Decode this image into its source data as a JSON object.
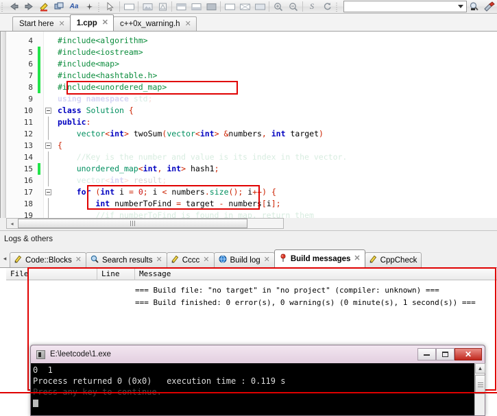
{
  "app": {
    "title": "Code::Blocks IDE"
  },
  "toolbar": {
    "items": [
      {
        "name": "back-arrow-icon",
        "glyph": "⇦"
      },
      {
        "name": "forward-arrow-icon",
        "glyph": "⇨"
      },
      {
        "name": "highlight-pen-icon",
        "glyph": "✎"
      },
      {
        "name": "copy-block-icon",
        "glyph": "❐"
      },
      {
        "name": "font-aa-icon",
        "glyph": "Aa"
      },
      {
        "name": "sparkle-icon",
        "glyph": "✳"
      },
      {
        "name": "pointer-select-icon",
        "glyph": "➤"
      },
      {
        "name": "rectangle-icon",
        "glyph": "▭"
      },
      {
        "name": "image-icon",
        "glyph": "▧"
      },
      {
        "name": "document-icon",
        "glyph": "△"
      },
      {
        "name": "panel-top-icon",
        "glyph": "▤"
      },
      {
        "name": "panel-split-icon",
        "glyph": "▥"
      },
      {
        "name": "panel-bottom-icon",
        "glyph": "▦"
      },
      {
        "name": "panel-fill-icon",
        "glyph": "■"
      },
      {
        "name": "frame-icon",
        "glyph": "▭"
      },
      {
        "name": "cross-box-icon",
        "glyph": "⌧"
      },
      {
        "name": "hatch-box-icon",
        "glyph": "▨"
      },
      {
        "name": "zoom-in-icon",
        "glyph": "⊕"
      },
      {
        "name": "zoom-out-icon",
        "glyph": "⊖"
      },
      {
        "name": "s-letter-icon",
        "glyph": "S"
      },
      {
        "name": "refresh-icon",
        "glyph": "⟳"
      }
    ],
    "combo_value": "",
    "dropdown_icon": "chevron-down-icon",
    "right_icons": [
      {
        "name": "magnifier-tool-icon",
        "glyph": "⌕"
      },
      {
        "name": "paint-tool-icon",
        "glyph": "✎"
      }
    ]
  },
  "editor_tabs": [
    {
      "label": "Start here",
      "active": false,
      "close": "✕"
    },
    {
      "label": "1.cpp",
      "active": true,
      "close": "✕"
    },
    {
      "label": "c++0x_warning.h",
      "active": false,
      "close": "✕"
    }
  ],
  "editor": {
    "first_line": 4,
    "lines": [
      {
        "num": 4,
        "marker": false,
        "fold": "",
        "faded": false
      },
      {
        "num": 5,
        "marker": true,
        "fold": "",
        "faded": false
      },
      {
        "num": 6,
        "marker": true,
        "fold": "",
        "faded": false
      },
      {
        "num": 7,
        "marker": true,
        "fold": "",
        "faded": false
      },
      {
        "num": 8,
        "marker": true,
        "fold": "",
        "faded": false
      },
      {
        "num": 9,
        "marker": false,
        "fold": "",
        "faded": true
      },
      {
        "num": 10,
        "marker": false,
        "fold": "box",
        "faded": false
      },
      {
        "num": 11,
        "marker": false,
        "fold": "line",
        "faded": false
      },
      {
        "num": 12,
        "marker": false,
        "fold": "line",
        "faded": false
      },
      {
        "num": 13,
        "marker": false,
        "fold": "box",
        "faded": false
      },
      {
        "num": 14,
        "marker": false,
        "fold": "line",
        "faded": true
      },
      {
        "num": 15,
        "marker": true,
        "fold": "line",
        "faded": false
      },
      {
        "num": 16,
        "marker": false,
        "fold": "line",
        "faded": true
      },
      {
        "num": 17,
        "marker": false,
        "fold": "box",
        "faded": false
      },
      {
        "num": 18,
        "marker": false,
        "fold": "line",
        "faded": false
      },
      {
        "num": 19,
        "marker": false,
        "fold": "line",
        "faded": true
      }
    ],
    "code_lines": [
      "#include<algorithm>",
      "#include<iostream>",
      "#include<map>",
      "#include<hashtable.h>",
      "#include<unordered_map>",
      "using namespace std;",
      "class Solution {",
      "public:",
      "    vector<int> twoSum(vector<int> &numbers, int target)",
      "{",
      "    //Key is the number and value is its index in the vector.",
      "    unordered_map<int, int> hash1;",
      "    vector<int> result;",
      "    for (int i = 0; i < numbers.size(); i++) {",
      "        int numberToFind = target - numbers[i];",
      "        //if numberToFind is found in map, return them"
    ],
    "highlight_boxes": [
      {
        "name": "include-unordered-map-highlight",
        "line": 8
      },
      {
        "name": "unordered-map-decl-highlight",
        "line": 15
      }
    ],
    "hscrollbar": {
      "left_arrow": "◂",
      "right_arrow": "▸"
    }
  },
  "logs_panel": {
    "caption": "Logs & others",
    "scroll_left_icon": "◂",
    "tabs": [
      {
        "label": "Code::Blocks",
        "icon": "pencil-icon",
        "active": false,
        "close": "✕"
      },
      {
        "label": "Search results",
        "icon": "magnifier-icon",
        "active": false,
        "close": "✕"
      },
      {
        "label": "Cccc",
        "icon": "pencil-icon",
        "active": false,
        "close": "✕"
      },
      {
        "label": "Build log",
        "icon": "globe-icon",
        "active": false,
        "close": "✕"
      },
      {
        "label": "Build messages",
        "icon": "pushpin-icon",
        "active": true,
        "close": "✕"
      },
      {
        "label": "CppCheck",
        "icon": "pencil-icon",
        "active": false,
        "close": ""
      }
    ]
  },
  "build_messages": {
    "columns": [
      "File",
      "Line",
      "Message"
    ],
    "rows": [
      {
        "file": "",
        "line": "",
        "message": "=== Build file: \"no target\" in \"no project\" (compiler: unknown) ==="
      },
      {
        "file": "",
        "line": "",
        "message": "=== Build finished: 0 error(s), 0 warning(s) (0 minute(s), 1 second(s)) ==="
      }
    ]
  },
  "console": {
    "title": "E:\\leetcode\\1.exe",
    "minimize_label": "minimize-icon",
    "maximize_label": "maximize-icon",
    "close_label": "✕",
    "output_lines": [
      {
        "text": "0  1",
        "faded": false
      },
      {
        "text": "Process returned 0 (0x0)   execution time : 0.119 s",
        "faded": false
      },
      {
        "text": "Press any key to continue.",
        "faded": true
      }
    ],
    "scrollbar": {
      "up_arrow": "▲",
      "down_arrow": "▼"
    }
  },
  "colors": {
    "highlight_red": "#e00000",
    "change_marker_green": "#22e44a",
    "keyword_blue": "#0000c0",
    "preprocessor_green": "#0b8c3c",
    "console_bg": "#000000"
  }
}
